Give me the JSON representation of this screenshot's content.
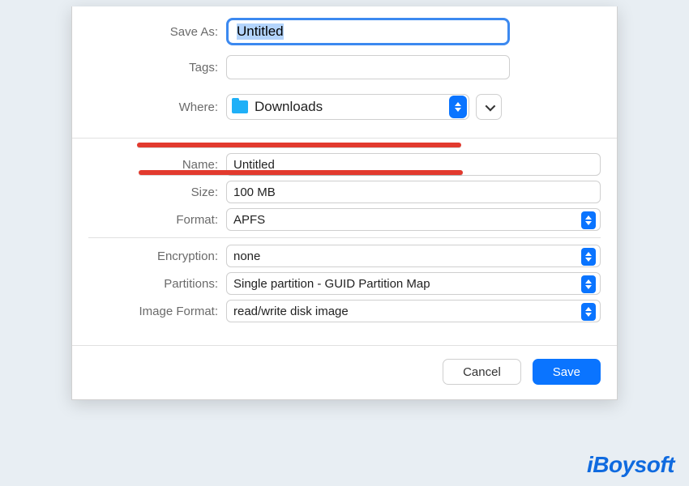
{
  "top": {
    "save_as_label": "Save As:",
    "save_as_value": "Untitled",
    "tags_label": "Tags:",
    "tags_value": "",
    "where_label": "Where:",
    "where_value": "Downloads"
  },
  "mid": {
    "name_label": "Name:",
    "name_value": "Untitled",
    "size_label": "Size:",
    "size_value": "100 MB",
    "format_label": "Format:",
    "format_value": "APFS",
    "encryption_label": "Encryption:",
    "encryption_value": "none",
    "partitions_label": "Partitions:",
    "partitions_value": "Single partition - GUID Partition Map",
    "image_format_label": "Image Format:",
    "image_format_value": "read/write disk image"
  },
  "footer": {
    "cancel": "Cancel",
    "save": "Save"
  },
  "watermark": "iBoysoft"
}
